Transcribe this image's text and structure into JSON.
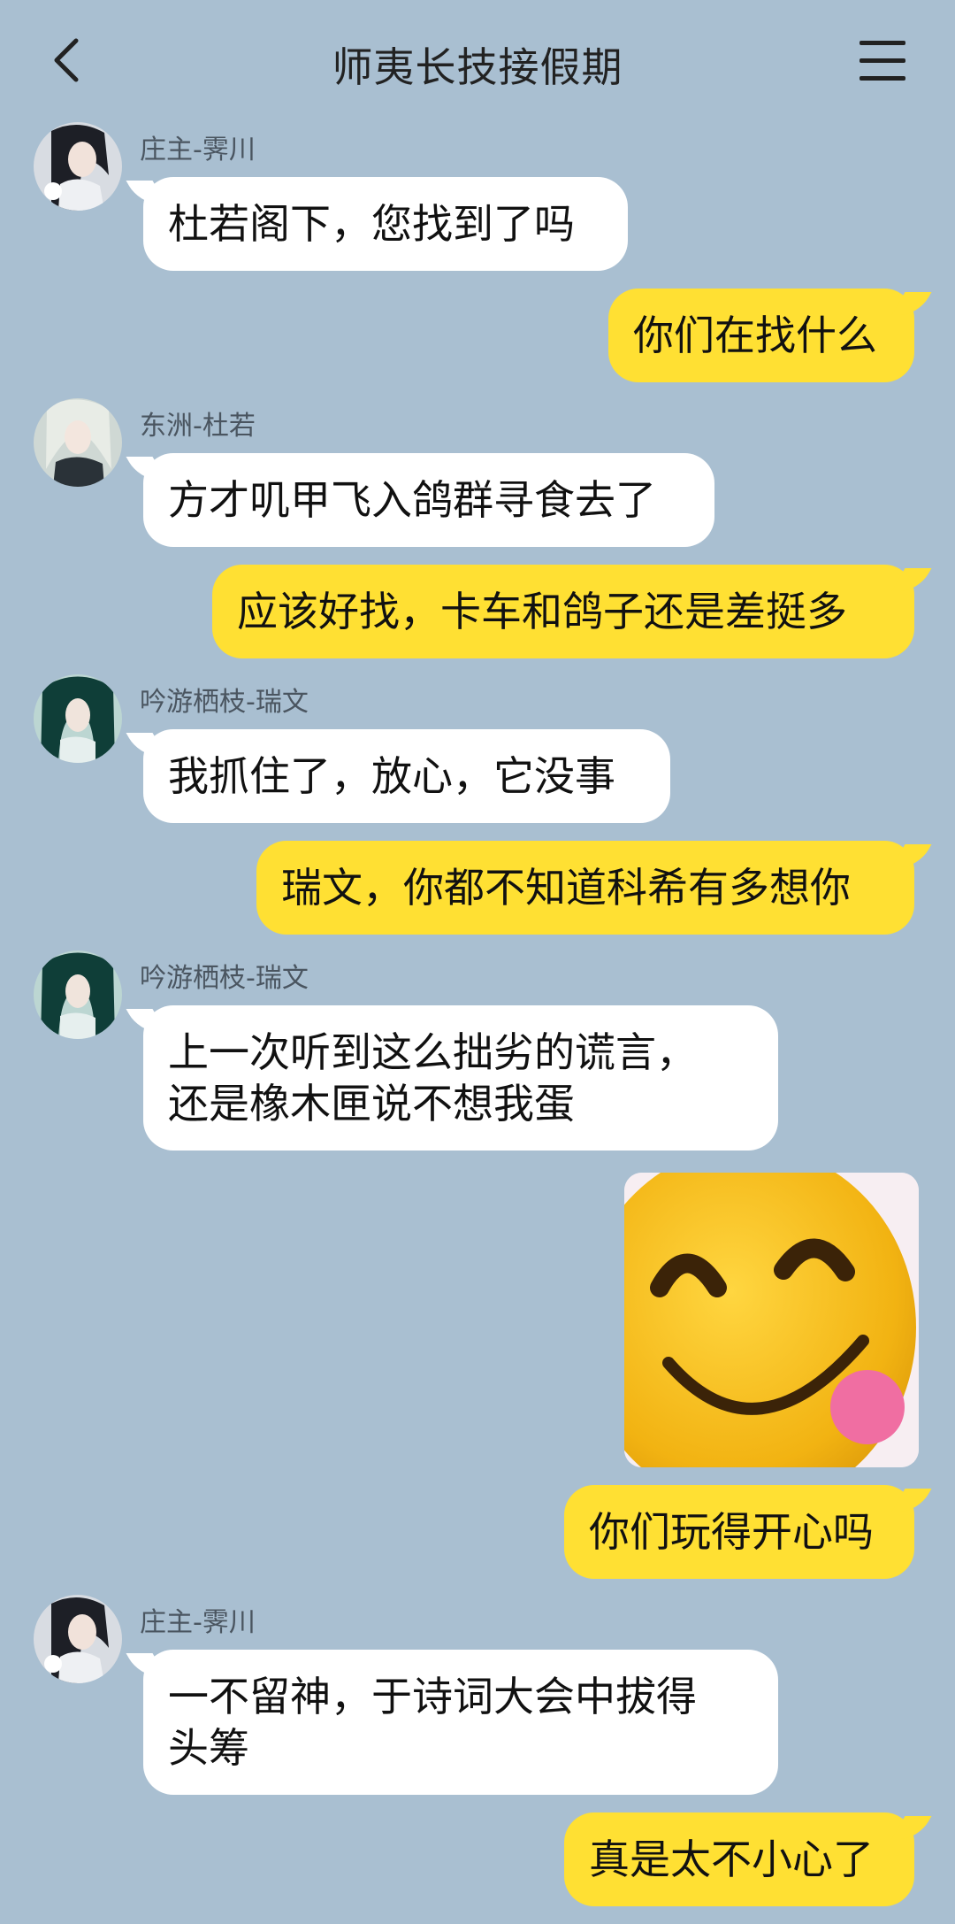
{
  "header": {
    "title": "师夷长技接假期",
    "back_icon": "chevron-left-icon",
    "menu_icon": "menu-icon"
  },
  "messages": [
    {
      "side": "left",
      "sender": "庄主-霁川",
      "text": "杜若阁下，您找到了吗"
    },
    {
      "side": "right",
      "text": "你们在找什么"
    },
    {
      "side": "left",
      "sender": "东洲-杜若",
      "text": "方才叽甲飞入鸽群寻食去了"
    },
    {
      "side": "right",
      "text": "应该好找，卡车和鸽子还是差挺多"
    },
    {
      "side": "left",
      "sender": "吟游栖枝-瑞文",
      "text": "我抓住了，放心，它没事"
    },
    {
      "side": "right",
      "text": "瑞文，你都不知道科希有多想你"
    },
    {
      "side": "left",
      "sender": "吟游栖枝-瑞文",
      "line1": "上一次听到这么拙劣的谎言，",
      "line2": "还是橡木匣说不想我蛋"
    },
    {
      "side": "right",
      "type": "sticker",
      "sticker_icon": "smiley-sticker-icon"
    },
    {
      "side": "right",
      "text": "你们玩得开心吗"
    },
    {
      "side": "left",
      "sender": "庄主-霁川",
      "line1": "一不留神，于诗词大会中拔得",
      "line2": "头筹"
    },
    {
      "side": "right",
      "text": "真是太不小心了"
    }
  ],
  "colors": {
    "background": "#a9bfd1",
    "my_bubble": "#ffe033",
    "their_bubble": "#ffffff"
  }
}
